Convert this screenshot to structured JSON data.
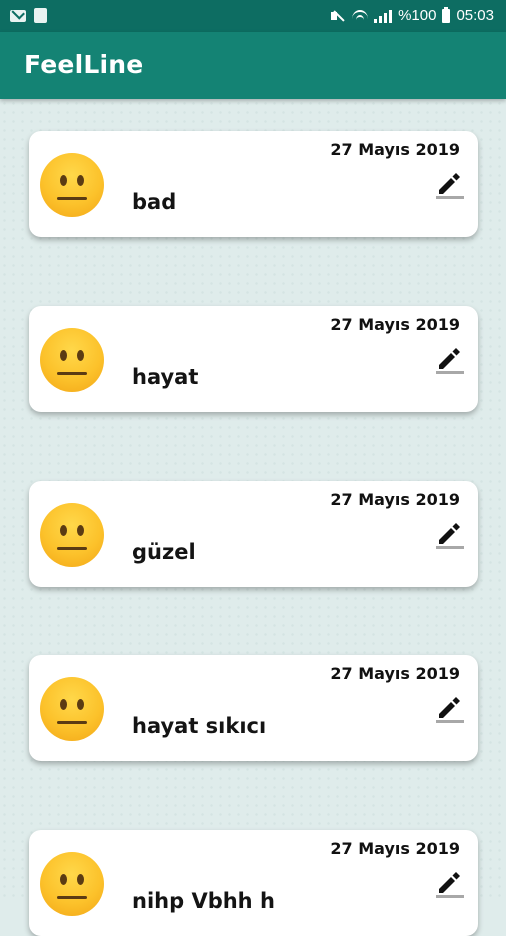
{
  "status_bar": {
    "left_icons": [
      "mail-icon",
      "app-icon"
    ],
    "right_icons": [
      "mute-icon",
      "wifi-icon",
      "signal-icon",
      "battery-icon"
    ],
    "battery": "%100",
    "time": "05:03"
  },
  "app_bar": {
    "title": "FeelLine",
    "color": "#148374"
  },
  "entries": [
    {
      "date": "27 Mayıs 2019",
      "text": "bad",
      "mood_icon": "neutral-face-emoji",
      "action_icon": "edit-pencil-icon"
    },
    {
      "date": "27 Mayıs 2019",
      "text": "hayat",
      "mood_icon": "neutral-face-emoji",
      "action_icon": "edit-pencil-icon"
    },
    {
      "date": "27 Mayıs 2019",
      "text": "güzel",
      "mood_icon": "neutral-face-emoji",
      "action_icon": "edit-pencil-icon"
    },
    {
      "date": "27 Mayıs 2019",
      "text": "hayat sıkıcı",
      "mood_icon": "neutral-face-emoji",
      "action_icon": "edit-pencil-icon"
    },
    {
      "date": "27 Mayıs 2019",
      "text": "nihp Vbhh h",
      "mood_icon": "neutral-face-emoji",
      "action_icon": "edit-pencil-icon"
    }
  ]
}
